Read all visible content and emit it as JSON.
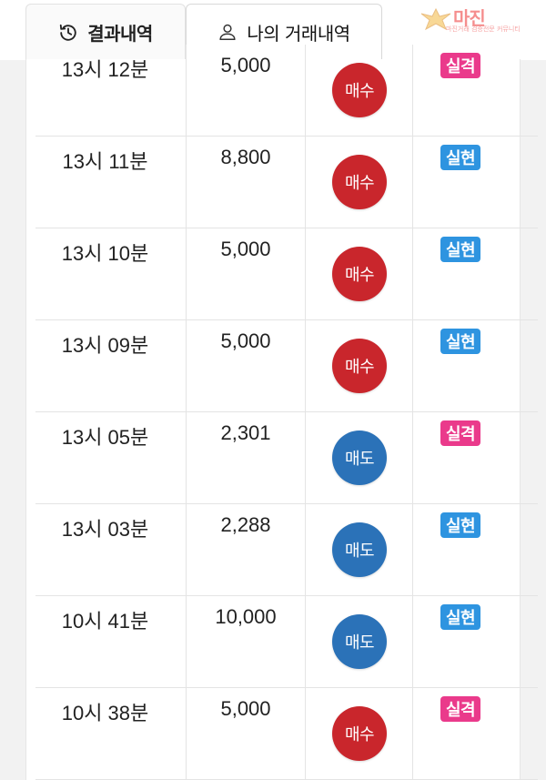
{
  "tabs": {
    "results_label": "결과내역",
    "mytrades_label": "나의 거래내역"
  },
  "watermark": {
    "logo_text": "마진",
    "sub_text": "마진거래 검증전문 커뮤니티"
  },
  "colors": {
    "buy": "#c9262c",
    "sell": "#2b72b8",
    "fail": "#ea3a8b",
    "success": "#2e94e0"
  },
  "trades": [
    {
      "time": "13시 12분",
      "amount": "5,000",
      "type": "매수",
      "type_kind": "buy",
      "result": "실격",
      "result_kind": "fail"
    },
    {
      "time": "13시 11분",
      "amount": "8,800",
      "type": "매수",
      "type_kind": "buy",
      "result": "실현",
      "result_kind": "success"
    },
    {
      "time": "13시 10분",
      "amount": "5,000",
      "type": "매수",
      "type_kind": "buy",
      "result": "실현",
      "result_kind": "success"
    },
    {
      "time": "13시 09분",
      "amount": "5,000",
      "type": "매수",
      "type_kind": "buy",
      "result": "실현",
      "result_kind": "success"
    },
    {
      "time": "13시 05분",
      "amount": "2,301",
      "type": "매도",
      "type_kind": "sell",
      "result": "실격",
      "result_kind": "fail"
    },
    {
      "time": "13시 03분",
      "amount": "2,288",
      "type": "매도",
      "type_kind": "sell",
      "result": "실현",
      "result_kind": "success"
    },
    {
      "time": "10시 41분",
      "amount": "10,000",
      "type": "매도",
      "type_kind": "sell",
      "result": "실현",
      "result_kind": "success"
    },
    {
      "time": "10시 38분",
      "amount": "5,000",
      "type": "매수",
      "type_kind": "buy",
      "result": "실격",
      "result_kind": "fail"
    }
  ]
}
